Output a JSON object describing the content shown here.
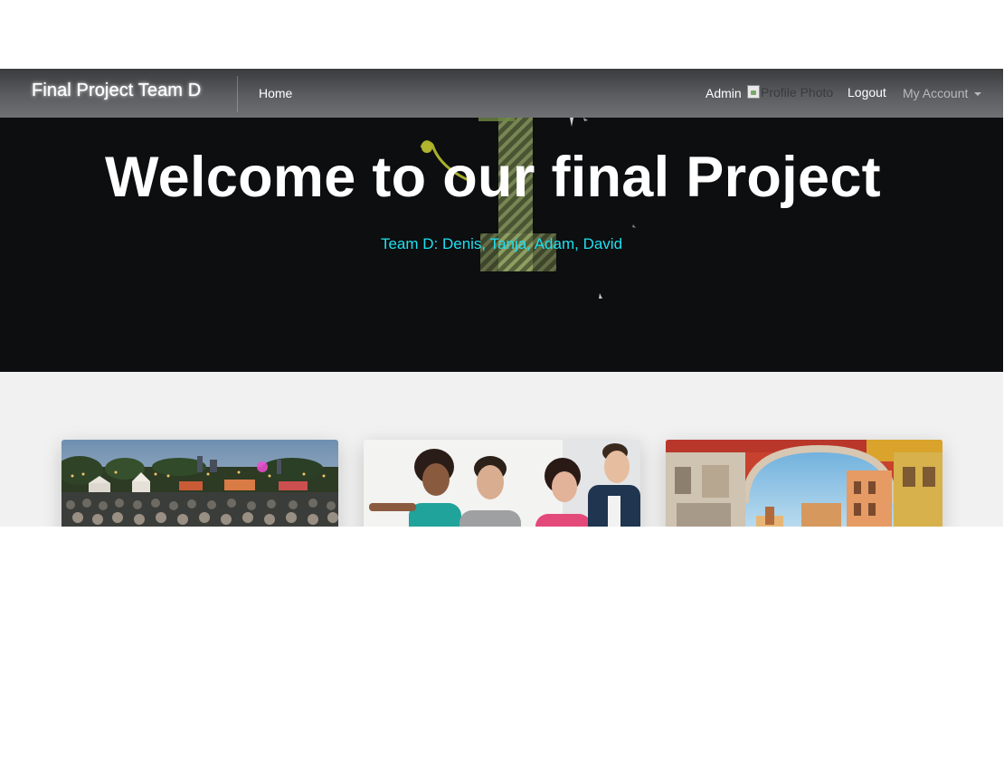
{
  "navbar": {
    "brand": "Final Project Team D",
    "home_label": "Home",
    "user_name": "Admin",
    "profile_photo_alt": "Profile Photo",
    "logout_label": "Logout",
    "account_label": "My Account"
  },
  "hero": {
    "title": "Welcome to our final Project",
    "subtitle": "Team D: Denis, Tanja, Adam, David"
  },
  "colors": {
    "navbar": "#5b5d60",
    "hero_background": "#0d0e10",
    "subtitle": "#1ee0f0",
    "content_background": "#f1f1f1"
  },
  "cards": [
    {
      "image": "festival-crowd-image"
    },
    {
      "image": "friends-laughing-image"
    },
    {
      "image": "city-archway-image"
    }
  ]
}
